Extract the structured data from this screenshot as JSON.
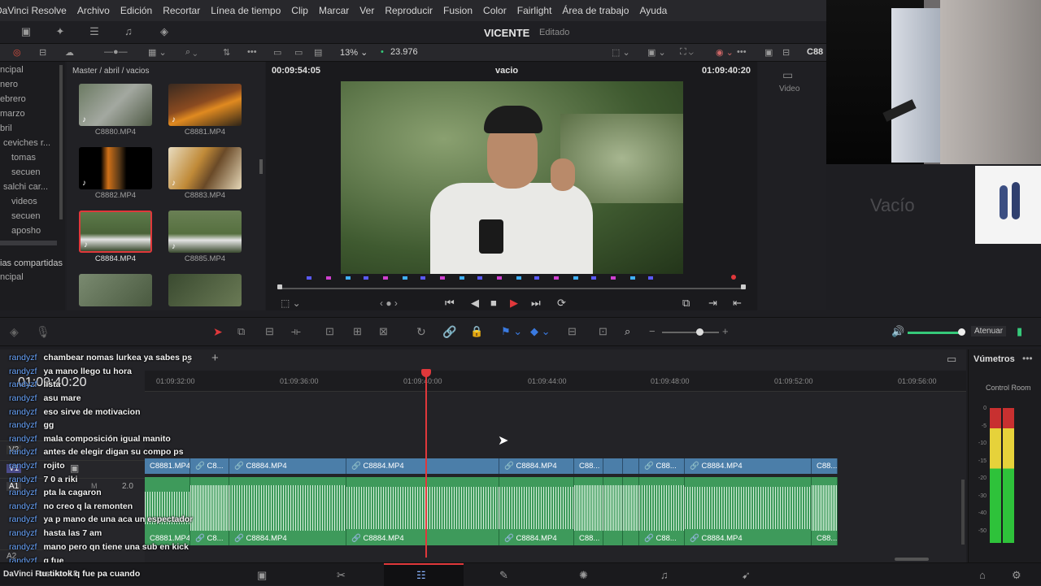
{
  "menubar": {
    "items": [
      "DaVinci Resolve",
      "Archivo",
      "Edición",
      "Recortar",
      "Línea de tiempo",
      "Clip",
      "Marcar",
      "Ver",
      "Reproducir",
      "Fusion",
      "Color",
      "Fairlight",
      "Área de trabajo",
      "Ayuda"
    ]
  },
  "project": {
    "title": "VICENTE",
    "status": "Editado"
  },
  "subbar": {
    "zoom": "13%",
    "fps": "23.976",
    "clip_label": "C88"
  },
  "bins": [
    "ncipal",
    "nero",
    "ebrero",
    "marzo",
    "bril",
    "ceviches r...",
    "tomas",
    "secuen",
    "salchi car...",
    "videos",
    "secuen",
    "aposho",
    "ias compartidas",
    "ncipal"
  ],
  "pool": {
    "breadcrumb": "Master / abril / vacios",
    "clips": [
      "C8880.MP4",
      "C8881.MP4",
      "C8882.MP4",
      "C8883.MP4",
      "C8884.MP4",
      "C8885.MP4"
    ]
  },
  "viewer": {
    "timecode_left": "00:09:54:05",
    "clip_name": "vacio",
    "timecode_right": "01:09:40:20"
  },
  "inspector": {
    "tab": "Video"
  },
  "right": {
    "empty_label": "Vacío"
  },
  "tltool": {
    "attenuate": "Atenuar"
  },
  "timeline": {
    "timecode": "01:09:40:20",
    "ticks": [
      "01:09:32:00",
      "01:09:36:00",
      "01:09:40:00",
      "01:09:44:00",
      "01:09:48:00",
      "01:09:52:00",
      "01:09:56:00"
    ],
    "tracks": {
      "v2": "V2",
      "v1": "V1",
      "a1": "A1",
      "a1_level": "2.0",
      "a2": "A2"
    },
    "video_clips": [
      "C8881.MP4",
      "C8...",
      "C8884.MP4",
      "C8884.MP4",
      "C8884.MP4",
      "C88...",
      "",
      "",
      "C88...",
      "C8884.MP4",
      "C88..."
    ],
    "audio_clips": [
      "C8881.MP4",
      "C8...",
      "C8884.MP4",
      "C8884.MP4",
      "C8884.MP4",
      "C88...",
      "",
      "",
      "C88...",
      "C8884.MP4",
      "C88..."
    ]
  },
  "meters": {
    "title": "Vúmetros",
    "room": "Control Room",
    "scale": [
      "0",
      "-5",
      "-10",
      "-15",
      "-20",
      "-30",
      "-40",
      "-50"
    ]
  },
  "chat": [
    {
      "user": "randyzf",
      "msg": "chambear nomas lurkea ya sabes ps"
    },
    {
      "user": "randyzf",
      "msg": "ya mano llego tu hora"
    },
    {
      "user": "randyzf",
      "msg": "lista"
    },
    {
      "user": "randyzf",
      "msg": "asu mare"
    },
    {
      "user": "randyzf",
      "msg": "eso sirve de motivacion"
    },
    {
      "user": "randyzf",
      "msg": "gg"
    },
    {
      "user": "randyzf",
      "msg": "mala composición igual manito"
    },
    {
      "user": "randyzf",
      "msg": "antes de elegir digan su compo ps"
    },
    {
      "user": "randyzf",
      "msg": "rojito"
    },
    {
      "user": "randyzf",
      "msg": "7 0 a riki"
    },
    {
      "user": "randyzf",
      "msg": "pta la cagaron"
    },
    {
      "user": "randyzf",
      "msg": "no creo q la remonten"
    },
    {
      "user": "randyzf",
      "msg": "ya p mano de una aca un espectador"
    },
    {
      "user": "randyzf",
      "msg": "hasta las 7 am"
    },
    {
      "user": "randyzf",
      "msg": "mano pero qn tiene una sub en kick"
    },
    {
      "user": "randyzf",
      "msg": "q fue"
    },
    {
      "user": "randyzf",
      "msg": "tu tiktok q fue pa cuando"
    }
  ],
  "footer": {
    "brand": "DaVinci Resolve 18"
  },
  "colors": {
    "video_clip": "#4b7ea9",
    "audio_clip": "#3e9a5b",
    "playhead": "#e0383b",
    "chat_user": "#6aa6ff"
  }
}
